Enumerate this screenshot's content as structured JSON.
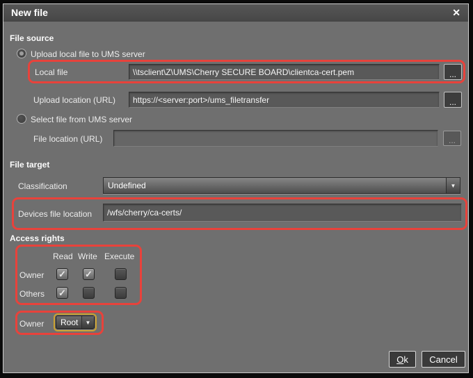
{
  "window": {
    "title": "New file"
  },
  "icons": {
    "close": "✕",
    "check": "✓",
    "dropdown_arrow": "▼",
    "browse": "..."
  },
  "colors": {
    "highlight_red": "#e8423b",
    "focus_yellow": "#caa12f",
    "titlebar": "#4e4e4e",
    "body_gray": "#6f6f6f"
  },
  "file_source": {
    "header": "File source",
    "upload_radio_label": "Upload local file to UMS server",
    "upload_radio_selected": true,
    "local_file_label": "Local file",
    "local_file_value": "\\\\tsclient\\Z\\UMS\\Cherry SECURE BOARD\\clientca-cert.pem",
    "upload_location_label": "Upload location (URL)",
    "upload_location_value": "https://<server:port>/ums_filetransfer",
    "select_radio_label": "Select file from UMS server",
    "select_radio_selected": false,
    "file_location_label": "File location (URL)",
    "file_location_value": ""
  },
  "file_target": {
    "header": "File target",
    "classification_label": "Classification",
    "classification_value": "Undefined",
    "devices_file_location_label": "Devices file location",
    "devices_file_location_value": "/wfs/cherry/ca-certs/"
  },
  "access_rights": {
    "header": "Access rights",
    "columns": [
      "Read",
      "Write",
      "Execute"
    ],
    "owner_row_label": "Owner",
    "others_row_label": "Others",
    "owner": {
      "read": true,
      "write": true,
      "execute": false
    },
    "others": {
      "read": true,
      "write": false,
      "execute": false
    },
    "owner_select_label": "Owner",
    "owner_select_value": "Root"
  },
  "footer": {
    "ok": "Ok",
    "cancel": "Cancel"
  }
}
